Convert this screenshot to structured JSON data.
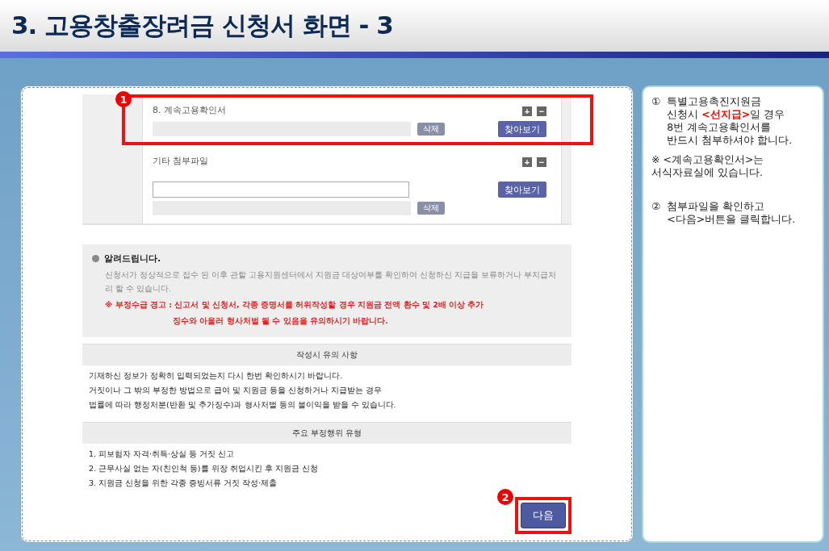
{
  "title": "3. 고용창출장려금 신청서 화면 - 3",
  "attachments": [
    {
      "kind": "single",
      "label": "8. 계속고용확인서",
      "highlighted": true,
      "marker": "1",
      "plus": "+",
      "minus": "−",
      "delete": "삭제",
      "browse": "찾아보기"
    },
    {
      "kind": "with-input",
      "label": "기타 첨부파일",
      "highlighted": false,
      "plus": "+",
      "minus": "−",
      "delete": "삭제",
      "browse": "찾아보기"
    }
  ],
  "notice": {
    "heading": "알려드립니다.",
    "body": "신청서가 정상적으로 접수 된 이후 관할 고용지원센터에서 지원금 대상여부를 확인하여 신청하신 지급을 보류하거나 부지급처리 할 수 있습니다.",
    "warning": [
      "※ 부정수급 경고 : 신고서 및 신청서, 각종 증명서를 허위작성할 경우 지원금 전액 환수 및 2배 이상 추가",
      "징수와 아울러 형사처벌 될 수 있음을 유의하시기 바랍니다."
    ]
  },
  "sections": [
    {
      "heading": "작성시 유의 사항",
      "lines": [
        "기재하신 정보가 정확히 입력되었는지 다시 한번 확인하시기 바랍니다.",
        "거짓이나 그 밖의 부정한 방법으로 급여 및 지원금 등을 신청하거나 지급받는 경우",
        "법률에 따라 행정처분(반환 및 추가징수)과 형사처벌 등의 불이익을 받을 수 있습니다."
      ]
    },
    {
      "heading": "주요 부정행위 유형",
      "lines": [
        "1. 피보험자 자격·취득·상실 등 거짓 신고",
        "2. 근무사실 없는 자(친인척 등)를 위장 취업시킨 후 지원금 신청",
        "3. 지원금 신청을 위한 각종 증빙서류 거짓 작성·제출"
      ]
    }
  ],
  "next_button": {
    "label": "다음",
    "highlighted": true,
    "marker": "2"
  },
  "notes": [
    {
      "marker": "①",
      "lines": [
        "특별고용촉진지원금",
        "신청시 **<선지급>**일 경우",
        "8번 계속고용확인서를",
        "반드시 첨부하셔야 합니다."
      ]
    },
    {
      "lines": [
        "※ <계속고용확인서>는",
        "서식자료실에 있습니다."
      ]
    },
    {
      "marker": "②",
      "lines": [
        "첨부파일을 확인하고",
        "<다음>버튼을 클릭합니다."
      ]
    }
  ]
}
